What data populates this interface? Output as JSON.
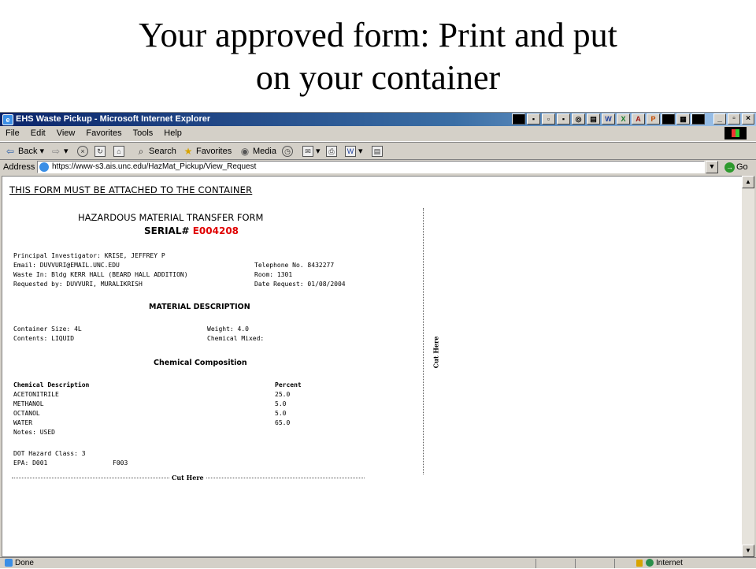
{
  "slide": {
    "title_line1": "Your approved form: Print and put",
    "title_line2": "on your container"
  },
  "window": {
    "title": "EHS Waste Pickup - Microsoft Internet Explorer"
  },
  "menu": [
    "File",
    "Edit",
    "View",
    "Favorites",
    "Tools",
    "Help"
  ],
  "toolbar": {
    "back": "Back",
    "search": "Search",
    "favorites": "Favorites",
    "media": "Media"
  },
  "address": {
    "label": "Address",
    "url": "https://www-s3.ais.unc.edu/HazMat_Pickup/View_Request",
    "go": "Go"
  },
  "form": {
    "attach_notice": "THIS FORM MUST BE ATTACHED TO THE CONTAINER",
    "title": "HAZARDOUS MATERIAL TRANSFER FORM",
    "serial_label": "SERIAL#",
    "serial_value": "E004208",
    "pi": "Principal Investigator: KRISE, JEFFREY P",
    "email": "Email: DUVVURI@EMAIL.UNC.EDU",
    "telephone": "Telephone No.  8432277",
    "waste_in": "Waste In: Bldg KERR HALL (BEARD HALL ADDITION)",
    "room": "Room: 1301",
    "requested_by": "Requested by: DUVVURI, MURALIKRISH",
    "date_request": "Date Request: 01/08/2004",
    "material_heading": "MATERIAL DESCRIPTION",
    "container_size": "Container Size: 4L",
    "weight": "Weight: 4.0",
    "contents": "Contents: LIQUID",
    "chemical_mixed": "Chemical Mixed:",
    "composition_heading": "Chemical Composition",
    "col_description": "Chemical Description",
    "col_percent": "Percent",
    "chemicals": [
      {
        "name": "ACETONITRILE",
        "percent": "25.0"
      },
      {
        "name": "METHANOL",
        "percent": "5.0"
      },
      {
        "name": "OCTANOL",
        "percent": "5.0"
      },
      {
        "name": "WATER",
        "percent": "65.0"
      }
    ],
    "notes": "Notes: USED",
    "dot_hazard": "DOT Hazard Class: 3",
    "epa_label": "EPA:  D001",
    "epa_code2": "F003",
    "cut_here": "Cut Here"
  },
  "status": {
    "text": "Done",
    "zone": "Internet"
  },
  "colors": {
    "serial": "#e00000",
    "titlebar": "#0a246a"
  }
}
